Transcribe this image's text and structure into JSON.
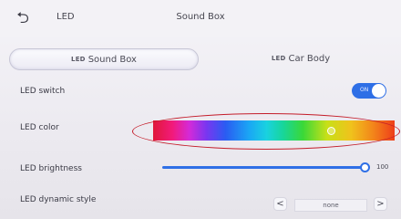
{
  "header": {
    "back_icon": "back-arrow-icon",
    "left_title": "LED",
    "center_title": "Sound Box"
  },
  "tabs": [
    {
      "icon_text": "LED",
      "label": "Sound Box",
      "selected": true
    },
    {
      "icon_text": "LED",
      "label": "Car Body",
      "selected": false
    }
  ],
  "settings": {
    "switch": {
      "label": "LED switch",
      "state_text": "ON",
      "on": true
    },
    "color": {
      "label": "LED color",
      "selected_hue_fraction": 0.74
    },
    "brightness": {
      "label": "LED brightness",
      "value": "100",
      "fraction": 1.0
    },
    "dynamic_style": {
      "label": "LED dynamic style",
      "value": "none",
      "prev": "<",
      "next": ">"
    }
  },
  "colors": {
    "accent": "#2f6fe6",
    "annotation": "#c41d2a"
  }
}
